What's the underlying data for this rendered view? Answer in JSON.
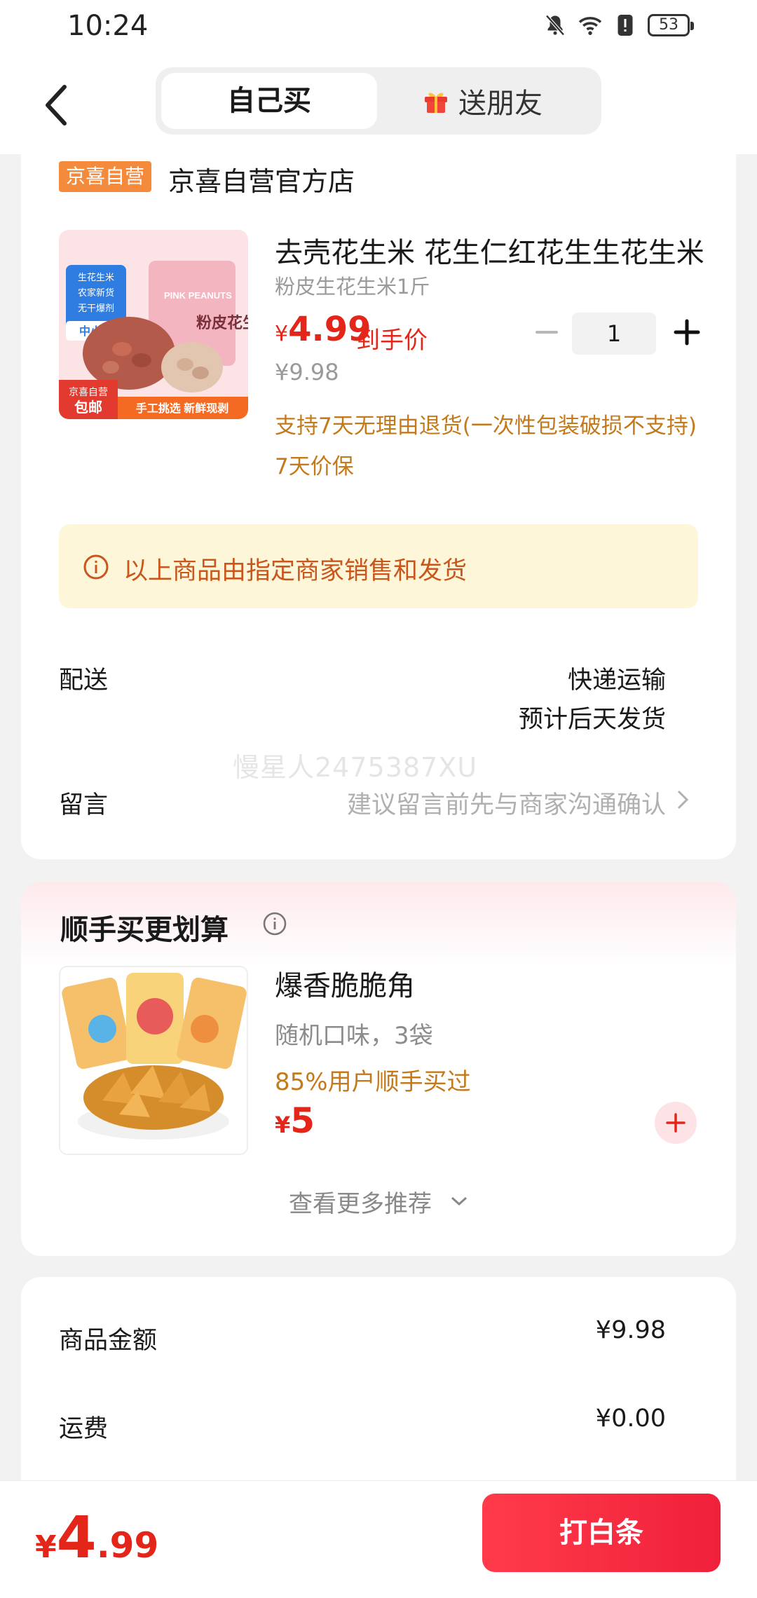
{
  "status": {
    "time": "10:24",
    "battery": "53"
  },
  "nav": {
    "tab_self": "自己买",
    "tab_gift": "送朋友"
  },
  "shop": {
    "badge": "京喜自营",
    "name": "京喜自营官方店"
  },
  "product": {
    "title": "去壳花生米 花生仁红花生生花生米",
    "spec": "粉皮生花生米1斤",
    "price_yen": "¥",
    "price": "4.99",
    "price_label": "到手价",
    "original_price": "¥9.98",
    "quantity": "1",
    "service": "支持7天无理由退货(一次性包装破损不支持)",
    "guarantee": "7天价保",
    "image_texts": {
      "tag1": "生花生米",
      "tag2": "农家新货",
      "tag3": "无干爆剂",
      "tag4": "中小粒",
      "brand_label": "粉皮花生",
      "pink": "PINK PEANUTS",
      "badge_top": "京喜自营",
      "badge_bottom": "包邮",
      "banner": "手工挑选 新鲜现剥"
    }
  },
  "notice": {
    "text": "以上商品由指定商家销售和发货"
  },
  "delivery": {
    "label": "配送",
    "method": "快递运输",
    "eta": "预计后天发货"
  },
  "watermark": "慢星人2475387XU",
  "message": {
    "label": "留言",
    "placeholder": "建议留言前先与商家沟通确认"
  },
  "addon": {
    "title": "顺手买更划算",
    "item_name": "爆香脆脆角",
    "item_desc": "随机口味，3袋",
    "social": "85%用户顺手买过",
    "price_yen": "¥",
    "price": "5",
    "more": "查看更多推荐"
  },
  "summary": {
    "goods_label": "商品金额",
    "goods_value": "¥9.98",
    "shipping_label": "运费",
    "shipping_value": "¥0.00"
  },
  "bottom": {
    "yen": "¥",
    "int": "4",
    "dec": ".99",
    "pay_label": "打白条"
  },
  "colors": {
    "accent_red": "#e4261a",
    "badge_orange": "#f48a3c",
    "service_brown": "#c47a1b",
    "notice_bg": "#fdf6d8"
  }
}
